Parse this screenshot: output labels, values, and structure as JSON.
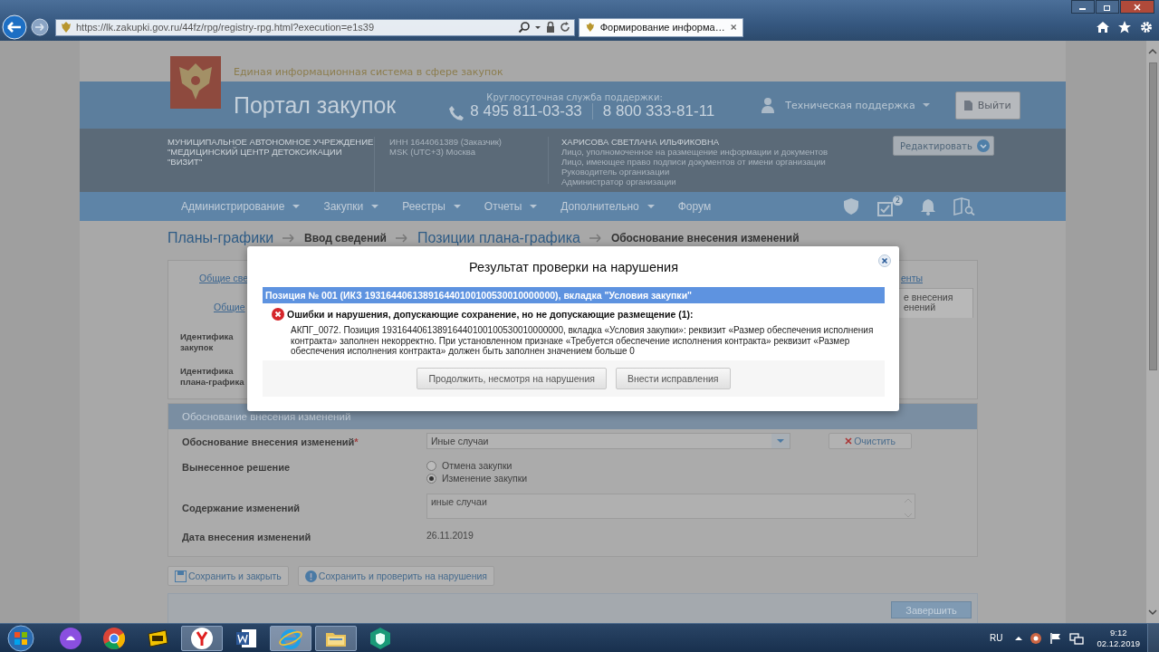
{
  "browser": {
    "url": "https://lk.zakupki.gov.ru/44fz/rpg/registry-rpg.html?execution=e1s39",
    "tab_title": "Формирование информа…"
  },
  "portal": {
    "system_name": "Единая информационная система в сфере закупок",
    "title": "Портал закупок",
    "support_label": "Круглосуточная служба поддержки:",
    "phones": [
      "8 495 811-03-33",
      "8 800 333-81-11"
    ],
    "support_menu": "Техническая поддержка",
    "logout": "Выйти"
  },
  "organization": {
    "name_lines": [
      "МУНИЦИПАЛЬНОЕ АВТОНОМНОЕ УЧРЕЖДЕНИЕ",
      "\"МЕДИЦИНСКИЙ ЦЕНТР ДЕТОКСИКАЦИИ",
      "\"ВИЗИТ\""
    ],
    "inn": "ИНН 1644061389 (Заказчик)",
    "timezone": "MSK (UTC+3) Москва",
    "user": "ХАРИСОВА СВЕТЛАНА ИЛЬФИКОВНА",
    "roles": [
      "Лицо, уполномоченное на размещение информации и документов",
      "Лицо, имеющее право подписи документов от имени организации",
      "Руководитель организации",
      "Администратор организации"
    ],
    "edit": "Редактировать"
  },
  "nav": {
    "items": [
      {
        "label": "Администрирование",
        "dropdown": true
      },
      {
        "label": "Закупки",
        "dropdown": true
      },
      {
        "label": "Реестры",
        "dropdown": true
      },
      {
        "label": "Отчеты",
        "dropdown": true
      },
      {
        "label": "Дополнительно",
        "dropdown": true
      },
      {
        "label": "Форум",
        "dropdown": false
      }
    ],
    "calendar_badge": "2"
  },
  "breadcrumbs": [
    {
      "label": "Планы-графики",
      "link": true
    },
    {
      "label": "Ввод сведений",
      "link": false
    },
    {
      "label": "Позиции плана-графика",
      "link": true
    },
    {
      "label": "Обоснование внесения изменений",
      "link": false
    }
  ],
  "tab_fragments": {
    "left": [
      "Общие све",
      "Общие"
    ],
    "right_link": "енты",
    "right_tab": [
      "е внесения",
      "енений"
    ]
  },
  "field_fragments": [
    {
      "lines": [
        "Идентифика",
        "закупок"
      ]
    },
    {
      "lines": [
        "Идентифика",
        "плана-графика"
      ]
    }
  ],
  "form": {
    "section_title": "Обоснование внесения изменений",
    "fields": [
      {
        "kind": "select",
        "label": "Обоснование внесения изменений",
        "required_mark": "*",
        "value": "Иные случаи",
        "clear": "Очистить"
      },
      {
        "kind": "radio",
        "label": "Вынесенное решение",
        "options": [
          {
            "label": "Отмена закупки",
            "selected": false
          },
          {
            "label": "Изменение закупки",
            "selected": true
          }
        ]
      },
      {
        "kind": "textarea",
        "label": "Содержание изменений",
        "value": "иные случаи"
      },
      {
        "kind": "text",
        "label": "Дата внесения изменений",
        "value": "26.11.2019"
      }
    ]
  },
  "actions": [
    {
      "kind": "save",
      "label": "Сохранить и закрыть"
    },
    {
      "kind": "check",
      "label": "Сохранить и проверить на нарушения"
    }
  ],
  "finish": "Завершить",
  "modal": {
    "title": "Результат проверки на нарушения",
    "position_header": "Позиция № 001 (ИКЗ 193164406138916440100100530010000000), вкладка \"Условия закупки\"",
    "error_heading": "Ошибки и нарушения, допускающие сохранение, но не допускающие размещение (1):",
    "error_text": "АКПГ_0072. Позиция 193164406138916440100100530010000000, вкладка «Условия закупки»: реквизит «Размер обеспечения исполнения контракта» заполнен некорректно. При установленном признаке «Требуется обеспечение исполнения контракта» реквизит «Размер обеспечения исполнения контракта» должен быть заполнен значением больше 0",
    "buttons": [
      "Продолжить, несмотря на нарушения",
      "Внести исправления"
    ]
  },
  "taskbar": {
    "language": "RU",
    "time": "9:12",
    "date": "02.12.2019"
  }
}
